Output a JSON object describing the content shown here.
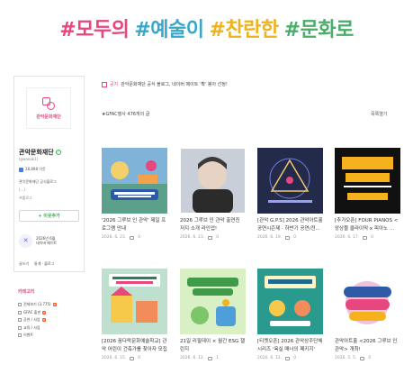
{
  "banner": {
    "words": [
      "#모두의",
      "#예술이",
      "#찬란한",
      "#문화로"
    ]
  },
  "profile": {
    "logo_text": "관악문화재단",
    "name": "관악문화재단",
    "blog_id": "(gwanak1)",
    "stats": "28,898 이웃",
    "desc": "관악문화재단 공식블로그",
    "more": "(...)",
    "more2": "프롤로그",
    "follow_label": "+ 이웃추가",
    "event_line1": "2026년 6월",
    "event_line2": "네이버 메이트",
    "footer_write": "글쓰기",
    "footer_stats": "통계 · 블로그"
  },
  "categories": {
    "title": "카테고리",
    "items": [
      {
        "label": "전체보기 (3,775)",
        "badge": "N"
      },
      {
        "label": "GFAC 출판",
        "badge": "N"
      },
      {
        "label": "공연 / 사업",
        "badge": "N"
      },
      {
        "label": "교육 / 사업",
        "badge": ""
      },
      {
        "label": "이벤트",
        "badge": ""
      }
    ]
  },
  "notice": {
    "label": "공지",
    "text": "관악문화재단 공식 블로그, 네이버 메이트 '확' 봉아 선정!"
  },
  "list": {
    "head": "★GFAC행사 476개의 글",
    "sort": "목록열기"
  },
  "posts": [
    {
      "title": "'2026 그루브 인 관악' 제일 프로그램 안내",
      "date": "2026. 6. 23.",
      "comments": "0"
    },
    {
      "title": "2026 그루브 인 관악 출연진 저지 소개 라인업!",
      "date": "2026. 6. 23.",
      "comments": "0"
    },
    {
      "title": "[관악 G.P.S] 2026 관악아트홀 공연시즌제 · 하반기 공연/전...",
      "date": "2026. 6. 19.",
      "comments": "0"
    },
    {
      "title": "[추가오픈] FOUR PIANOS < 앙상블 클라이막 x 피아노 ...",
      "date": "2026. 6. 17.",
      "comments": "0"
    },
    {
      "title": "[2026 꿈다락문화예술학교] 관악 어린이 건축가를 찾아자 모집",
      "date": "2026. 6. 15.",
      "comments": "0"
    },
    {
      "title": "21일 리필데이 × 월간 ESG 챌린지",
      "date": "2026. 6. 12.",
      "comments": "1"
    },
    {
      "title": "[티켓오픈] 2026 관악상주단체 시리즈 '욕실 매너의 패키지'",
      "date": "2026. 6. 12.",
      "comments": "0"
    },
    {
      "title": "관악아트홀 <2026 그루브 인 관악> 개최!",
      "date": "2026. 5. 5.",
      "comments": "0"
    }
  ]
}
